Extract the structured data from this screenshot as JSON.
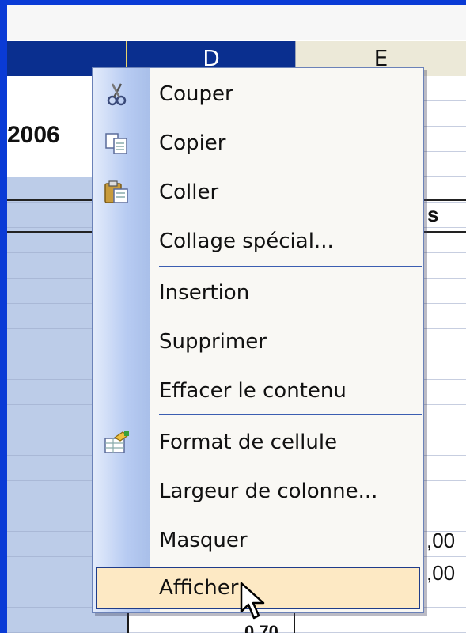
{
  "spreadsheet": {
    "columns": [
      "D",
      "E"
    ],
    "year": "2006",
    "edge_s": "s",
    "edge_value_1": ",00",
    "edge_value_2": ",00",
    "edge_partial_1": "-",
    "edge_partial_2": "0.70"
  },
  "context_menu": {
    "items": [
      {
        "label": "Couper",
        "icon": "scissors-icon"
      },
      {
        "label": "Copier",
        "icon": "copy-icon"
      },
      {
        "label": "Coller",
        "icon": "paste-icon"
      },
      {
        "label": "Collage spécial...",
        "icon": ""
      },
      {
        "label": "Insertion",
        "icon": ""
      },
      {
        "label": "Supprimer",
        "icon": ""
      },
      {
        "label": "Effacer le contenu",
        "icon": ""
      },
      {
        "label": "Format de cellule",
        "icon": "format-cells-icon"
      },
      {
        "label": "Largeur de colonne...",
        "icon": ""
      },
      {
        "label": "Masquer",
        "icon": ""
      },
      {
        "label": "Afficher",
        "icon": ""
      }
    ],
    "highlighted": "Afficher",
    "colors": {
      "highlight_fill": "#fde9c4",
      "highlight_border": "#1f3c8a",
      "icon_strip": "#b7cbf2",
      "separator": "#3b5eb1",
      "column_header_selected": "#0a2f8f",
      "selected_cells": "#bccce8"
    }
  }
}
